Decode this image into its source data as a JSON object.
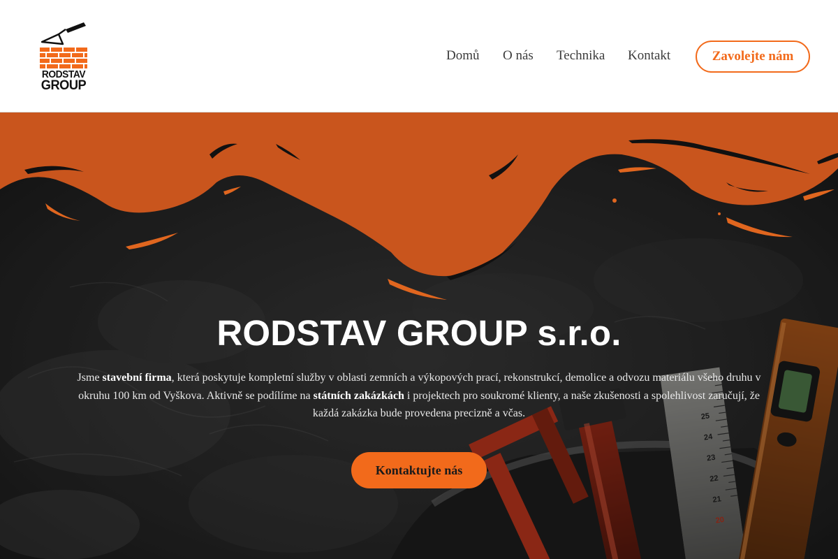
{
  "brand": {
    "line1": "RODSTAV",
    "line2": "GROUP",
    "accent_color": "#f26a1b",
    "dark_orange": "#c9551d"
  },
  "nav": {
    "items": [
      {
        "label": "Domů"
      },
      {
        "label": "O nás"
      },
      {
        "label": "Technika"
      },
      {
        "label": "Kontakt"
      }
    ],
    "cta_label": "Zavolejte nám"
  },
  "hero": {
    "title": "RODSTAV GROUP s.r.o.",
    "desc_p1": "Jsme ",
    "desc_b1": "stavební firma",
    "desc_p2": ", která poskytuje kompletní služby v oblasti zemních a výkopových prací, rekonstrukcí, demolice a odvozu materiálu všeho druhu v okruhu 100 km od Vyškova. Aktivně se podílíme na ",
    "desc_b2": "státních zakázkách",
    "desc_p3": " i projektech pro soukromé klienty, a naše zkušenosti a spolehlivost zaručují, že každá zakázka bude provedena precizně a včas.",
    "button_label": "Kontaktujte nás",
    "ruler_numbers": [
      "25",
      "24",
      "23",
      "22",
      "21",
      "20"
    ]
  }
}
